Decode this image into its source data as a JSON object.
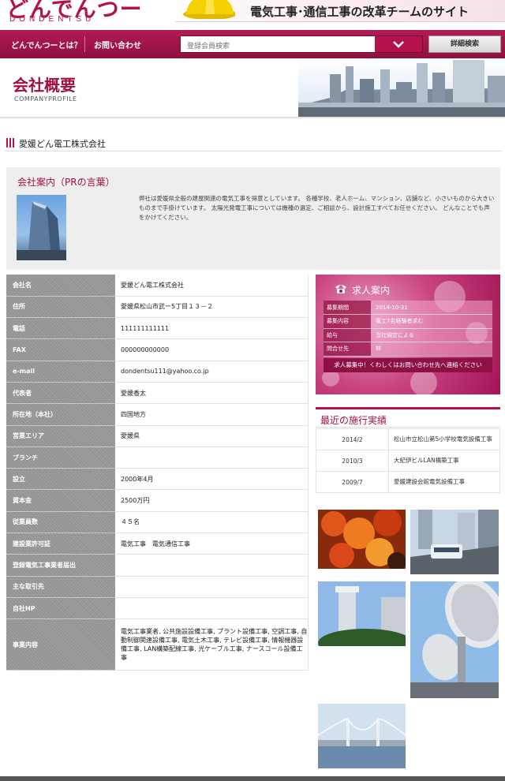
{
  "header": {
    "logo_text": "どんでんつー",
    "logo_sub": "DONDENTSU",
    "banner_text": "電気工事･通信工事の改革チームのサイト"
  },
  "nav": {
    "items": [
      "どんでんつーとは？",
      "お問い合わせ"
    ],
    "search_placeholder": "登録会員検索",
    "detail_search": "詳細検索"
  },
  "page": {
    "title": "会社概要",
    "subtitle": "COMPANYPROFILE",
    "company_heading": "愛媛どん電工株式会社"
  },
  "pr": {
    "title": "会社案内（PRの言葉）",
    "text": "弊社は愛媛県全般の建屋関連の電気工事を得意としています。 各種学校、老人ホーム、マンション、店舗など、小さいものから大きいものまで手掛けています。 太陽光発電工事については機種の選定、ご相談から、設計施工すべてお任せください。 どんなことでも声をかけてください。"
  },
  "info": [
    {
      "key": "会社名",
      "value": "愛媛どん電工株式会社"
    },
    {
      "key": "住所",
      "value": "愛媛県松山市武ー5丁目１３－２"
    },
    {
      "key": "電話",
      "value": "111111111111"
    },
    {
      "key": "FAX",
      "value": "000000000000"
    },
    {
      "key": "e-mail",
      "value": "dondentsu111@yahoo.co.jp"
    },
    {
      "key": "代表者",
      "value": "愛媛香太"
    },
    {
      "key": "所在地（本社）",
      "value": "四国地方"
    },
    {
      "key": "営業エリア",
      "value": "愛媛県"
    },
    {
      "key": "ブランチ",
      "value": ""
    },
    {
      "key": "設立",
      "value": "2000年4月"
    },
    {
      "key": "資本金",
      "value": "2500万円"
    },
    {
      "key": "従業員数",
      "value": "４５名"
    },
    {
      "key": "建設業許可証",
      "value": "電気工事　電気通信工事"
    },
    {
      "key": "登録電気工事業者届出",
      "value": ""
    },
    {
      "key": "主な取引先",
      "value": ""
    },
    {
      "key": "自社HP",
      "value": ""
    },
    {
      "key": "事業内容",
      "value": "電気工事業者, 公共施設設備工事, プラント設備工事, 空調工事, 自動制御関連設備工事, 電気土木工事, テレビ設備工事, 情報機器設備工事, LAN構築配線工事, 光ケーブル工事, ナースコール設備工事"
    }
  ],
  "recruit": {
    "title": "求人案内",
    "rows": [
      {
        "key": "募集期間",
        "value": "2014-10-31"
      },
      {
        "key": "募集内容",
        "value": "電工7名経験者求む"
      },
      {
        "key": "給与",
        "value": "当社規定による"
      },
      {
        "key": "問合せ先",
        "value": "林"
      }
    ],
    "note": "求人募集中！くわしくはお問い合わせ先へ連絡ください"
  },
  "works": {
    "title": "最近の施行実績",
    "rows": [
      {
        "date": "2014/2",
        "name": "松山市立松山第5小学校電気設備工事"
      },
      {
        "date": "2010/3",
        "name": "大紀伊ビルLAN構築工事"
      },
      {
        "date": "2009/7",
        "name": "愛媛建設会館電気設備工事"
      }
    ]
  }
}
